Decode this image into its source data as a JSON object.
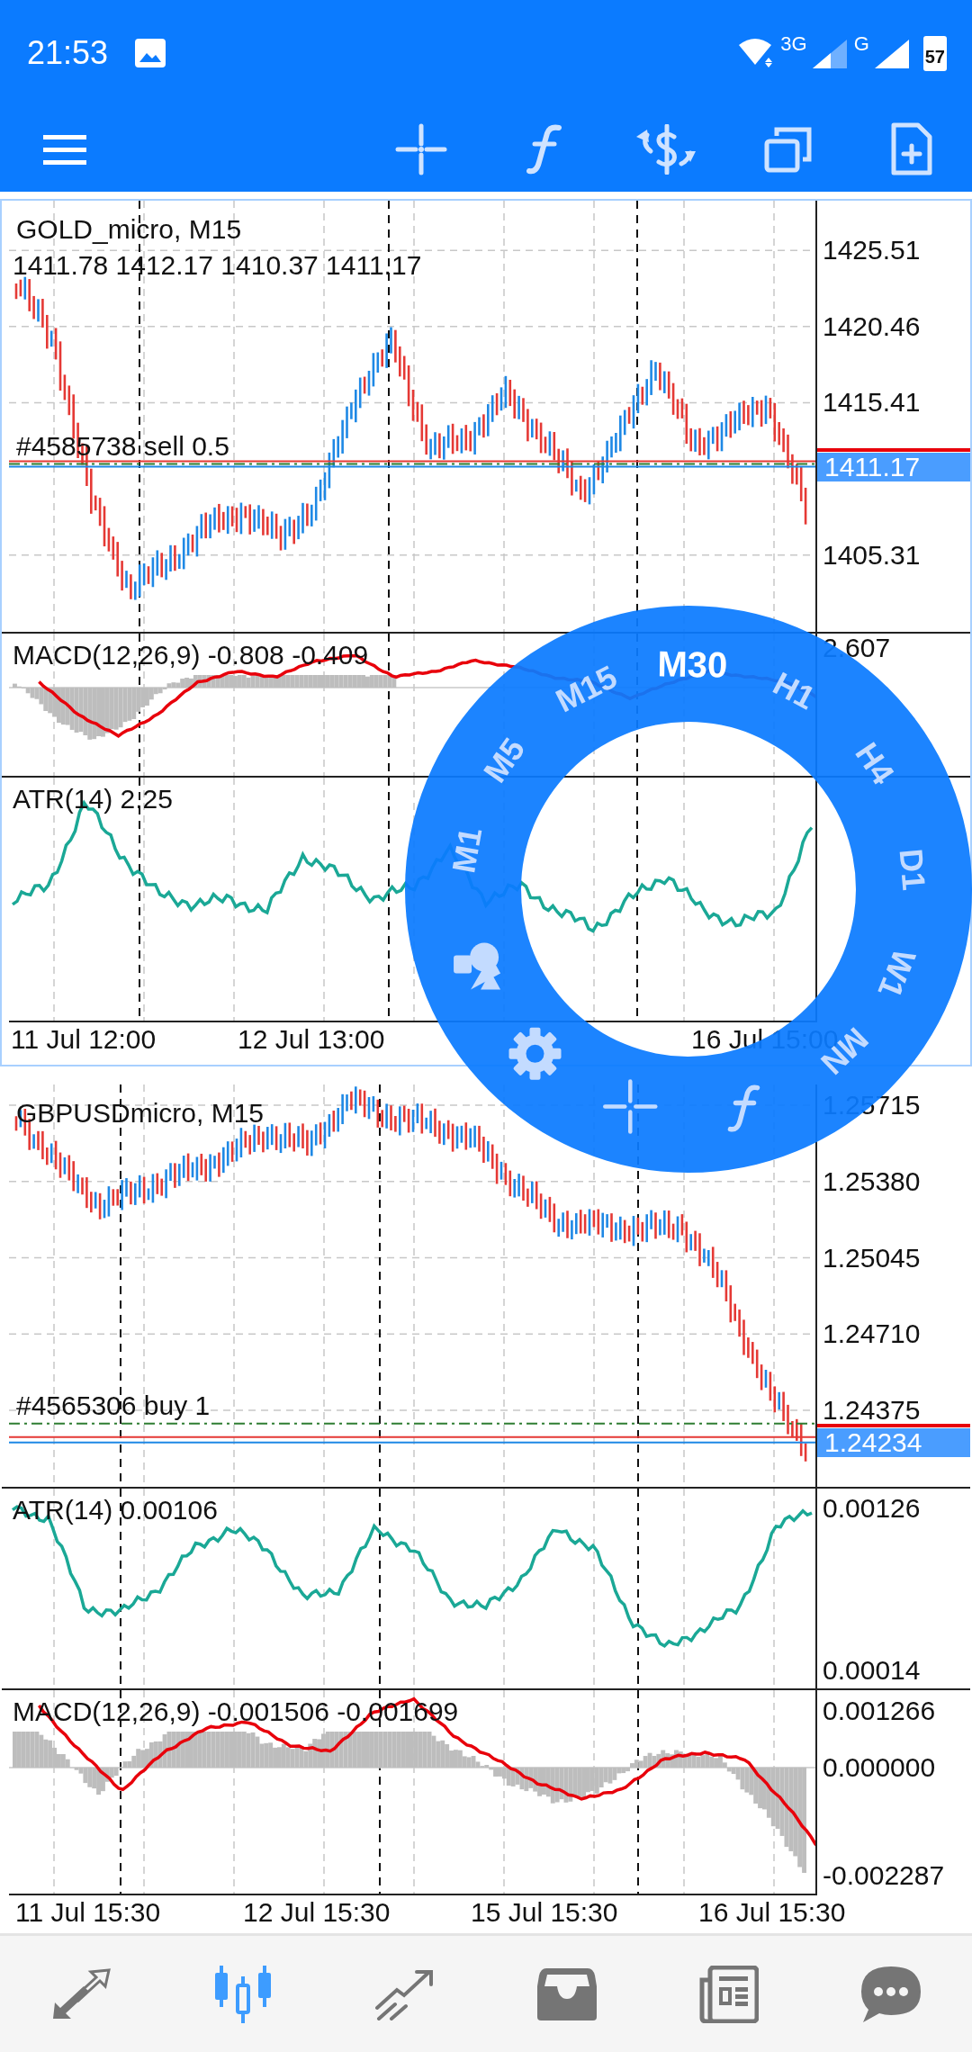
{
  "status_bar": {
    "time": "21:53",
    "network_1": "3G",
    "network_2": "G",
    "battery": "57"
  },
  "charts": [
    {
      "active": true,
      "title": "GOLD_micro, M15",
      "ohlc": "1411.78 1412.17 1410.37 1411.17",
      "price_levels": [
        "1425.51",
        "1420.46",
        "1415.41",
        "1405.31"
      ],
      "current_price": "1411.17",
      "order_label": "#4585738 sell 0.5",
      "indicators": [
        {
          "kind": "macd",
          "label": "MACD(12,26,9) -0.808 -0.409",
          "levels": [
            "2.607"
          ]
        },
        {
          "kind": "atr",
          "label": "ATR(14) 2.25"
        }
      ],
      "time_labels": [
        "11 Jul 12:00",
        "12 Jul 13:00",
        "16 Jul 15:00"
      ]
    },
    {
      "active": false,
      "title": "GBPUSDmicro, M15",
      "price_levels": [
        "1.25715",
        "1.25380",
        "1.25045",
        "1.24710",
        "1.24375"
      ],
      "current_price": "1.24234",
      "order_label": "#4565306 buy 1",
      "indicators": [
        {
          "kind": "atr",
          "label": "ATR(14) 0.00106",
          "levels": [
            "0.00126",
            "0.00014"
          ]
        },
        {
          "kind": "macd",
          "label": "MACD(12,26,9) -0.001506 -0.001699",
          "levels": [
            "0.001266",
            "0.000000",
            "-0.002287"
          ]
        }
      ],
      "time_labels": [
        "11 Jul 15:30",
        "12 Jul 15:30",
        "15 Jul 15:30",
        "16 Jul 15:30"
      ]
    }
  ],
  "period_dial": {
    "periods": [
      {
        "label": "M1",
        "selected": false
      },
      {
        "label": "M5",
        "selected": false
      },
      {
        "label": "M15",
        "selected": false
      },
      {
        "label": "M30",
        "selected": true
      },
      {
        "label": "H1",
        "selected": false
      },
      {
        "label": "H4",
        "selected": false
      },
      {
        "label": "D1",
        "selected": false
      },
      {
        "label": "W1",
        "selected": false
      },
      {
        "label": "MN",
        "selected": false
      }
    ]
  },
  "bottom_nav": [
    {
      "selected": false
    },
    {
      "selected": true
    },
    {
      "selected": false
    },
    {
      "selected": false
    },
    {
      "selected": false
    },
    {
      "selected": false
    }
  ]
}
